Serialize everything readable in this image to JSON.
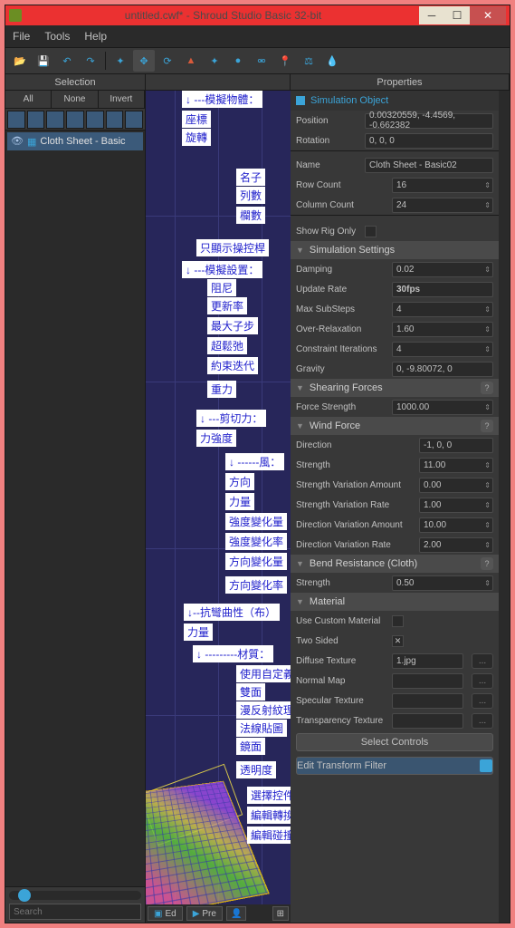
{
  "window": {
    "title": "untitled.cwf* - Shroud Studio Basic 32-bit"
  },
  "menu": {
    "file": "File",
    "tools": "Tools",
    "help": "Help"
  },
  "panels": {
    "selection": "Selection",
    "properties": "Properties"
  },
  "selection": {
    "tabs": {
      "all": "All",
      "none": "None",
      "invert": "Invert"
    },
    "item": "Cloth Sheet - Basic"
  },
  "search": {
    "placeholder": "Search"
  },
  "viewport": {
    "btn_ed": "Ed",
    "btn_pre": "Pre"
  },
  "annotations": {
    "sim_obj": "↓ ---模擬物體：",
    "position": "座標",
    "rotation": "旋轉",
    "name": "名子",
    "row": "列數",
    "column": "欄數",
    "rig_only": "只顯示操控桿",
    "sim_set": "↓ ---模擬設置：",
    "damping": "阻尼",
    "update": "更新率",
    "substeps": "最大子步",
    "overrelax": "超鬆弛",
    "constraint": "約束迭代",
    "gravity": "重力",
    "shear": "↓ ---剪切力：",
    "force_str": "力強度",
    "wind": "↓ ------風：",
    "direction": "方向",
    "strength": "力量",
    "str_var_amt": "強度變化量",
    "str_var_rate": "強度變化率",
    "dir_var_amt": "方向變化量",
    "dir_var_rate": "方向變化率",
    "bend": "↓--抗彎曲性（布）",
    "bend_str": "力量",
    "material": "↓ ---------材質：",
    "use_custom": "使用自定義",
    "two_sided": "雙面",
    "diffuse": "漫反射紋理",
    "normal": "法線貼圖",
    "specular": "鏡面",
    "transparency": "透明度",
    "sel_ctrl": "選擇控件",
    "edit_trans": "編輯轉換過濾器",
    "edit_col": "編輯碰撞過濾器"
  },
  "props": {
    "sim_object": {
      "header": "Simulation Object",
      "position_l": "Position",
      "position_v": "0.00320559, -4.4569, -0.662382",
      "rotation_l": "Rotation",
      "rotation_v": "0, 0, 0",
      "name_l": "Name",
      "name_v": "Cloth Sheet - Basic02",
      "row_l": "Row Count",
      "row_v": "16",
      "col_l": "Column Count",
      "col_v": "24",
      "rig_l": "Show Rig Only"
    },
    "sim_settings": {
      "header": "Simulation Settings",
      "damping_l": "Damping",
      "damping_v": "0.02",
      "update_l": "Update Rate",
      "update_v": "30fps",
      "sub_l": "Max SubSteps",
      "sub_v": "4",
      "over_l": "Over-Relaxation",
      "over_v": "1.60",
      "con_l": "Constraint Iterations",
      "con_v": "4",
      "grav_l": "Gravity",
      "grav_v": "0, -9.80072, 0"
    },
    "shear": {
      "header": "Shearing Forces",
      "force_l": "Force Strength",
      "force_v": "1000.00"
    },
    "wind": {
      "header": "Wind Force",
      "dir_l": "Direction",
      "dir_v": "-1, 0, 0",
      "str_l": "Strength",
      "str_v": "11.00",
      "sva_l": "Strength Variation Amount",
      "sva_v": "0.00",
      "svr_l": "Strength Variation Rate",
      "svr_v": "1.00",
      "dva_l": "Direction Variation Amount",
      "dva_v": "10.00",
      "dvr_l": "Direction Variation Rate",
      "dvr_v": "2.00"
    },
    "bend": {
      "header": "Bend Resistance (Cloth)",
      "str_l": "Strength",
      "str_v": "0.50"
    },
    "material": {
      "header": "Material",
      "custom_l": "Use Custom Material",
      "two_l": "Two Sided",
      "diff_l": "Diffuse Texture",
      "diff_v": "1.jpg",
      "norm_l": "Normal Map",
      "spec_l": "Specular Texture",
      "trans_l": "Transparency Texture",
      "dots": "..."
    },
    "actions": {
      "select_controls": "Select Controls",
      "edit_transform": "Edit Transform Filter"
    }
  }
}
